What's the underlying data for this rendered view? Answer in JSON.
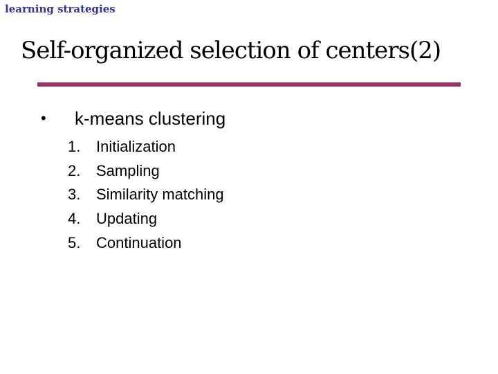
{
  "header": {
    "label": "learning strategies"
  },
  "slide": {
    "title": "Self-organized selection of centers(2)",
    "accent_color": "#993366",
    "bullet": {
      "symbol": "•",
      "text": "k-means clustering"
    },
    "steps": [
      {
        "num": "1.",
        "text": "Initialization"
      },
      {
        "num": "2.",
        "text": "Sampling"
      },
      {
        "num": "3.",
        "text": "Similarity matching"
      },
      {
        "num": "4.",
        "text": "Updating"
      },
      {
        "num": "5.",
        "text": "Continuation"
      }
    ]
  }
}
